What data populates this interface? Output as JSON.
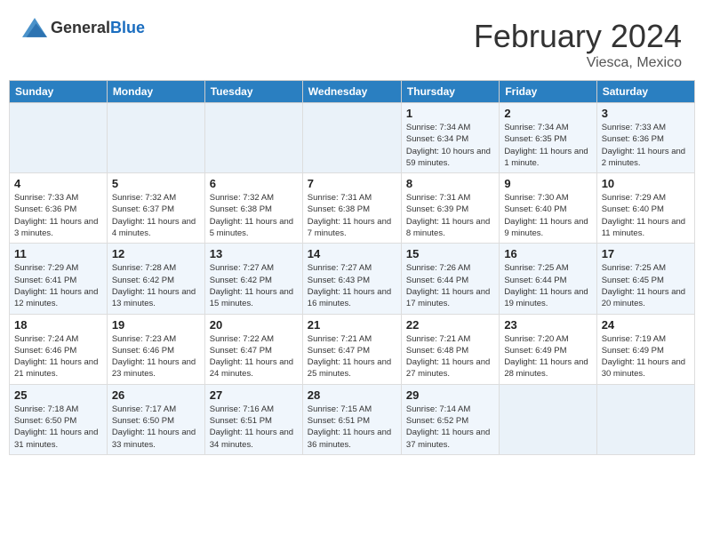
{
  "header": {
    "logo_general": "General",
    "logo_blue": "Blue",
    "title": "February 2024",
    "location": "Viesca, Mexico"
  },
  "weekdays": [
    "Sunday",
    "Monday",
    "Tuesday",
    "Wednesday",
    "Thursday",
    "Friday",
    "Saturday"
  ],
  "weeks": [
    [
      {
        "day": "",
        "info": ""
      },
      {
        "day": "",
        "info": ""
      },
      {
        "day": "",
        "info": ""
      },
      {
        "day": "",
        "info": ""
      },
      {
        "day": "1",
        "info": "Sunrise: 7:34 AM\nSunset: 6:34 PM\nDaylight: 10 hours and 59 minutes."
      },
      {
        "day": "2",
        "info": "Sunrise: 7:34 AM\nSunset: 6:35 PM\nDaylight: 11 hours and 1 minute."
      },
      {
        "day": "3",
        "info": "Sunrise: 7:33 AM\nSunset: 6:36 PM\nDaylight: 11 hours and 2 minutes."
      }
    ],
    [
      {
        "day": "4",
        "info": "Sunrise: 7:33 AM\nSunset: 6:36 PM\nDaylight: 11 hours and 3 minutes."
      },
      {
        "day": "5",
        "info": "Sunrise: 7:32 AM\nSunset: 6:37 PM\nDaylight: 11 hours and 4 minutes."
      },
      {
        "day": "6",
        "info": "Sunrise: 7:32 AM\nSunset: 6:38 PM\nDaylight: 11 hours and 5 minutes."
      },
      {
        "day": "7",
        "info": "Sunrise: 7:31 AM\nSunset: 6:38 PM\nDaylight: 11 hours and 7 minutes."
      },
      {
        "day": "8",
        "info": "Sunrise: 7:31 AM\nSunset: 6:39 PM\nDaylight: 11 hours and 8 minutes."
      },
      {
        "day": "9",
        "info": "Sunrise: 7:30 AM\nSunset: 6:40 PM\nDaylight: 11 hours and 9 minutes."
      },
      {
        "day": "10",
        "info": "Sunrise: 7:29 AM\nSunset: 6:40 PM\nDaylight: 11 hours and 11 minutes."
      }
    ],
    [
      {
        "day": "11",
        "info": "Sunrise: 7:29 AM\nSunset: 6:41 PM\nDaylight: 11 hours and 12 minutes."
      },
      {
        "day": "12",
        "info": "Sunrise: 7:28 AM\nSunset: 6:42 PM\nDaylight: 11 hours and 13 minutes."
      },
      {
        "day": "13",
        "info": "Sunrise: 7:27 AM\nSunset: 6:42 PM\nDaylight: 11 hours and 15 minutes."
      },
      {
        "day": "14",
        "info": "Sunrise: 7:27 AM\nSunset: 6:43 PM\nDaylight: 11 hours and 16 minutes."
      },
      {
        "day": "15",
        "info": "Sunrise: 7:26 AM\nSunset: 6:44 PM\nDaylight: 11 hours and 17 minutes."
      },
      {
        "day": "16",
        "info": "Sunrise: 7:25 AM\nSunset: 6:44 PM\nDaylight: 11 hours and 19 minutes."
      },
      {
        "day": "17",
        "info": "Sunrise: 7:25 AM\nSunset: 6:45 PM\nDaylight: 11 hours and 20 minutes."
      }
    ],
    [
      {
        "day": "18",
        "info": "Sunrise: 7:24 AM\nSunset: 6:46 PM\nDaylight: 11 hours and 21 minutes."
      },
      {
        "day": "19",
        "info": "Sunrise: 7:23 AM\nSunset: 6:46 PM\nDaylight: 11 hours and 23 minutes."
      },
      {
        "day": "20",
        "info": "Sunrise: 7:22 AM\nSunset: 6:47 PM\nDaylight: 11 hours and 24 minutes."
      },
      {
        "day": "21",
        "info": "Sunrise: 7:21 AM\nSunset: 6:47 PM\nDaylight: 11 hours and 25 minutes."
      },
      {
        "day": "22",
        "info": "Sunrise: 7:21 AM\nSunset: 6:48 PM\nDaylight: 11 hours and 27 minutes."
      },
      {
        "day": "23",
        "info": "Sunrise: 7:20 AM\nSunset: 6:49 PM\nDaylight: 11 hours and 28 minutes."
      },
      {
        "day": "24",
        "info": "Sunrise: 7:19 AM\nSunset: 6:49 PM\nDaylight: 11 hours and 30 minutes."
      }
    ],
    [
      {
        "day": "25",
        "info": "Sunrise: 7:18 AM\nSunset: 6:50 PM\nDaylight: 11 hours and 31 minutes."
      },
      {
        "day": "26",
        "info": "Sunrise: 7:17 AM\nSunset: 6:50 PM\nDaylight: 11 hours and 33 minutes."
      },
      {
        "day": "27",
        "info": "Sunrise: 7:16 AM\nSunset: 6:51 PM\nDaylight: 11 hours and 34 minutes."
      },
      {
        "day": "28",
        "info": "Sunrise: 7:15 AM\nSunset: 6:51 PM\nDaylight: 11 hours and 36 minutes."
      },
      {
        "day": "29",
        "info": "Sunrise: 7:14 AM\nSunset: 6:52 PM\nDaylight: 11 hours and 37 minutes."
      },
      {
        "day": "",
        "info": ""
      },
      {
        "day": "",
        "info": ""
      }
    ]
  ]
}
